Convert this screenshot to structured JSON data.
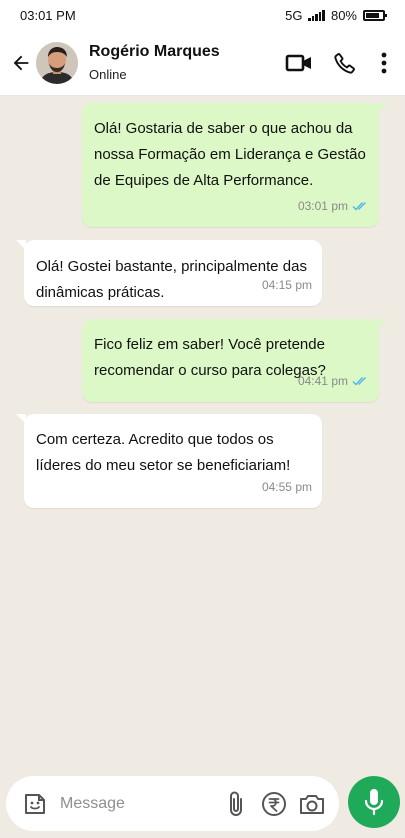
{
  "status_bar": {
    "time": "03:01 PM",
    "network": "5G",
    "battery": "80%"
  },
  "header": {
    "contact_name": "Rogério Marques",
    "contact_status": "Online"
  },
  "messages": [
    {
      "direction": "out",
      "text": "Olá! Gostaria de saber o que achou da nossa Formação em Liderança e Gestão de Equipes de Alta Performance.",
      "time": "03:01 pm",
      "read": true
    },
    {
      "direction": "in",
      "text": "Olá! Gostei bastante, principalmente das dinâmicas práticas.",
      "time": "04:15 pm"
    },
    {
      "direction": "out",
      "text": "Fico feliz em saber! Você pretende recomendar o curso para colegas?",
      "time": "04:41 pm",
      "read": true
    },
    {
      "direction": "in",
      "text": "Com certeza. Acredito que todos os líderes do meu setor se beneficiariam!",
      "time": "04:55 pm"
    }
  ],
  "composer": {
    "placeholder": "Message"
  },
  "icons": [
    "back-arrow-icon",
    "video-call-icon",
    "phone-icon",
    "more-options-icon",
    "sticker-icon",
    "attach-icon",
    "rupee-payment-icon",
    "camera-icon",
    "microphone-icon",
    "double-check-icon"
  ],
  "colors": {
    "outgoing_bubble": "#dcf8c6",
    "incoming_bubble": "#ffffff",
    "chat_background": "#efeae2",
    "mic_button": "#1faa59",
    "read_ticks": "#4fb6ec"
  }
}
